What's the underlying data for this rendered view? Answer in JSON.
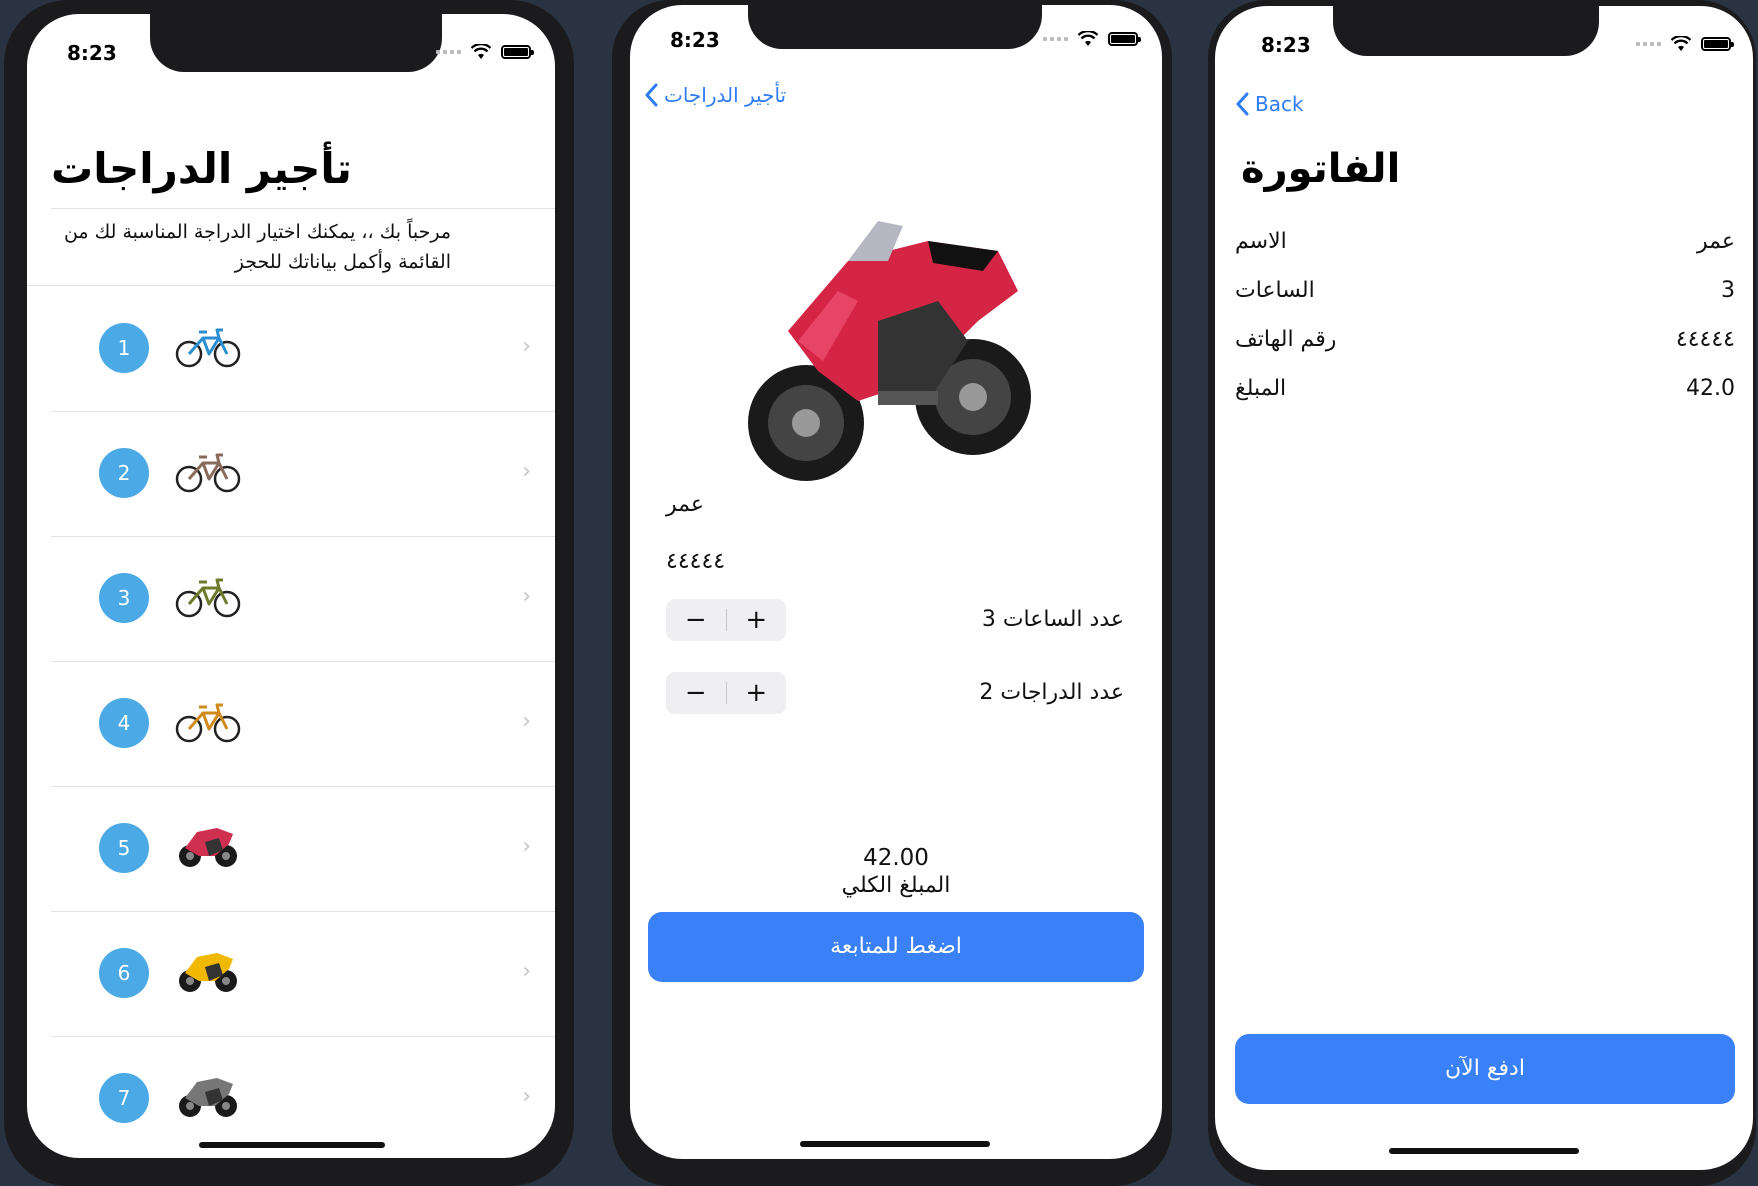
{
  "status": {
    "time": "8:23"
  },
  "screen1": {
    "title": "تأجير الدراجات",
    "desc_line1": "مرحباً بك ،، يمكنك اختيار الدراجة المناسبة لك من",
    "desc_line2": "القائمة وأكمل بياناتك للحجز",
    "items": [
      {
        "num": "1",
        "kind": "bicycle",
        "color": "#2a8fd0"
      },
      {
        "num": "2",
        "kind": "bicycle",
        "color": "#8a6a5a"
      },
      {
        "num": "3",
        "kind": "bicycle",
        "color": "#6b7a2a"
      },
      {
        "num": "4",
        "kind": "bicycle",
        "color": "#d08a1a"
      },
      {
        "num": "5",
        "kind": "motorcycle",
        "color": "#d03050"
      },
      {
        "num": "6",
        "kind": "motorcycle",
        "color": "#f0b800"
      },
      {
        "num": "7",
        "kind": "motorcycle",
        "color": "#777777"
      }
    ],
    "chevron": "›"
  },
  "screen2": {
    "back_label": "تأجير الدراجات",
    "name": "عمر",
    "phone": "٤٤٤٤٤",
    "hours_label": "عدد الساعات 3",
    "bikes_label": "عدد الدراجات 2",
    "minus": "−",
    "plus": "+",
    "total_value": "42.00",
    "total_label": "المبلغ الكلي",
    "continue_label": "اضغط للمتابعة",
    "accent": "#d42545"
  },
  "screen3": {
    "back_label": "Back",
    "title": "الفاتورة",
    "rows": [
      {
        "key": "الاسم",
        "value": "عمر"
      },
      {
        "key": "الساعات",
        "value": "3"
      },
      {
        "key": "رقم الهاتف",
        "value": "٤٤٤٤٤"
      },
      {
        "key": "المبلغ",
        "value": "42.0"
      }
    ],
    "pay_label": "ادفع الآن"
  },
  "colors": {
    "blue": "#3a80f6",
    "badge": "#4ba9e6"
  }
}
